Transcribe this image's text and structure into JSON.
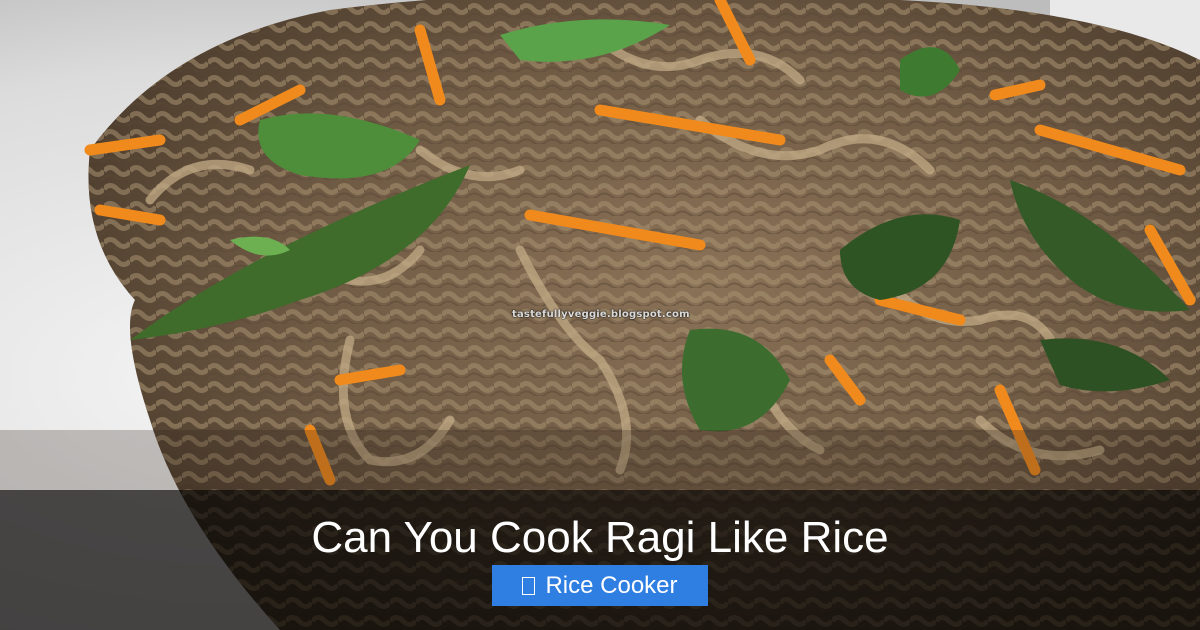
{
  "image": {
    "subject": "stir-fried ragi noodles with grated carrot, curry leaves and coriander",
    "watermark": "tastefullyveggie.blogspot.com"
  },
  "overlay": {
    "title": "Can You Cook Ragi Like Rice",
    "category_icon": "category-icon",
    "category_label": "Rice Cooker",
    "colors": {
      "banner": "#000000",
      "badge": "#2f7ee2",
      "text": "#ffffff"
    }
  }
}
